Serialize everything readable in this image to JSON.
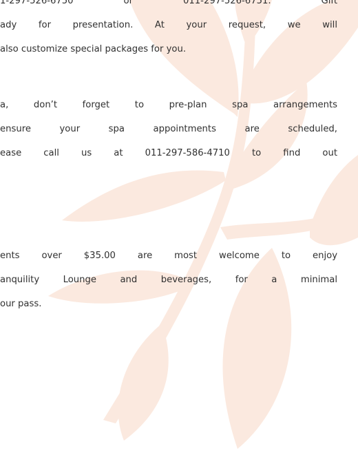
{
  "paragraphs": [
    {
      "lines": [
        "1-297-526-6750 or 011-297-526-6751. Gift",
        "ady for presentation. At your request, we will",
        "also customize special packages for you."
      ]
    },
    {
      "lines": [
        "a, don’t forget to pre-plan spa arrangements",
        "ensure your spa appointments are scheduled,",
        "ease call us at 011-297-586-4710 to find out"
      ]
    },
    {
      "lines": [
        "ents over $35.00 are most welcome to enjoy",
        "anquility Lounge and beverages, for a minimal",
        "our pass."
      ]
    }
  ],
  "colors": {
    "text": "#303030",
    "leaf": "#fbe9df",
    "background": "#ffffff"
  }
}
